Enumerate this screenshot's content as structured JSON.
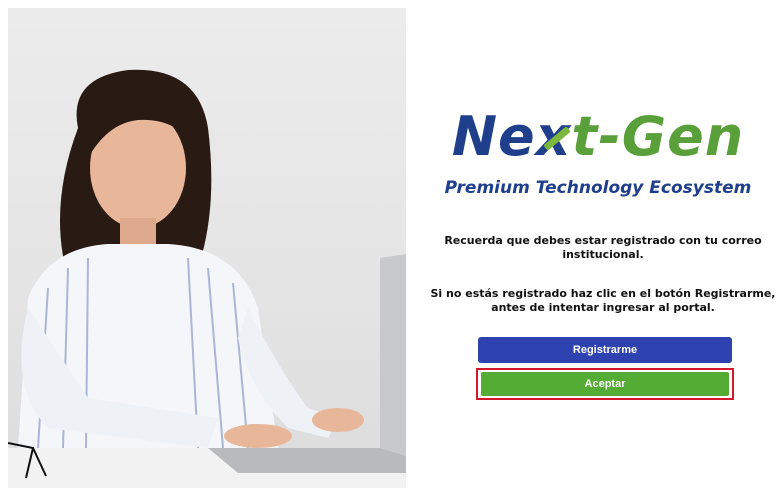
{
  "photo": {
    "description_icon": "woman-using-laptop-image"
  },
  "brand": {
    "name_part1": "Ne",
    "name_x": "x",
    "name_part2": "t-Gen",
    "tagline": "Premium Technology Ecosystem",
    "colors": {
      "blue": "#1f3f8c",
      "green": "#5aa03a"
    }
  },
  "messages": {
    "line1": "Recuerda que debes estar registrado con tu correo institucional.",
    "line2": "Si no estás registrado haz clic en el botón Registrarme, antes de intentar ingresar al portal."
  },
  "buttons": {
    "register_label": "Registrarme",
    "accept_label": "Aceptar",
    "register_color": "#2f43b0",
    "accept_color": "#54ac34",
    "highlight_color": "#d3182b"
  }
}
